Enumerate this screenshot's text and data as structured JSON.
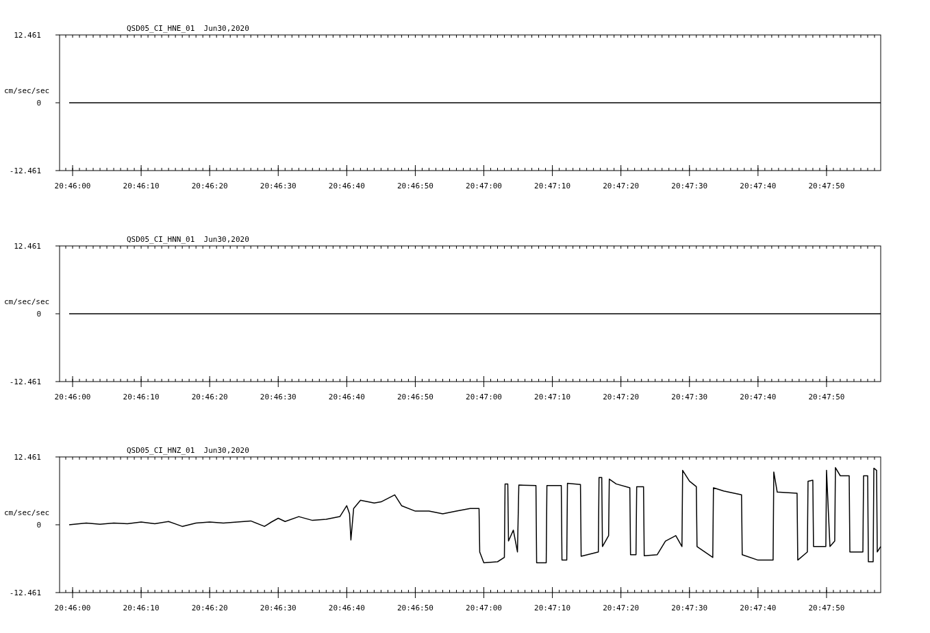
{
  "charts": [
    {
      "chart_data": {
        "type": "line",
        "title": "QSD05_CI_HNE_01  Jun30,2020",
        "ylabel": "cm/sec/sec",
        "xlim": [
          74758.1,
          74877.9
        ],
        "ylim": [
          -12.461,
          12.461
        ],
        "yticks": [
          {
            "value": 12.461,
            "label": "12.461"
          },
          {
            "value": 0,
            "label": "0"
          },
          {
            "value": -12.461,
            "label": "-12.461"
          }
        ],
        "xticks": [
          {
            "value": 74760,
            "label": "20:46:00"
          },
          {
            "value": 74770,
            "label": "20:46:10"
          },
          {
            "value": 74780,
            "label": "20:46:20"
          },
          {
            "value": 74790,
            "label": "20:46:30"
          },
          {
            "value": 74800,
            "label": "20:46:40"
          },
          {
            "value": 74810,
            "label": "20:46:50"
          },
          {
            "value": 74820,
            "label": "20:47:00"
          },
          {
            "value": 74830,
            "label": "20:47:10"
          },
          {
            "value": 74840,
            "label": "20:47:20"
          },
          {
            "value": 74850,
            "label": "20:47:30"
          },
          {
            "value": 74860,
            "label": "20:47:40"
          },
          {
            "value": 74870,
            "label": "20:47:50"
          }
        ],
        "x": [
          74759.5,
          74877.9
        ],
        "series": [
          {
            "color": "#000000",
            "values": [
              0,
              0
            ]
          }
        ]
      }
    },
    {
      "chart_data": {
        "type": "line",
        "title": "QSD05_CI_HNN_01  Jun30,2020",
        "ylabel": "cm/sec/sec",
        "xlim": [
          74758.1,
          74877.9
        ],
        "ylim": [
          -12.461,
          12.461
        ],
        "yticks": [
          {
            "value": 12.461,
            "label": "12.461"
          },
          {
            "value": 0,
            "label": "0"
          },
          {
            "value": -12.461,
            "label": "-12.461"
          }
        ],
        "xticks": [
          {
            "value": 74760,
            "label": "20:46:00"
          },
          {
            "value": 74770,
            "label": "20:46:10"
          },
          {
            "value": 74780,
            "label": "20:46:20"
          },
          {
            "value": 74790,
            "label": "20:46:30"
          },
          {
            "value": 74800,
            "label": "20:46:40"
          },
          {
            "value": 74810,
            "label": "20:46:50"
          },
          {
            "value": 74820,
            "label": "20:47:00"
          },
          {
            "value": 74830,
            "label": "20:47:10"
          },
          {
            "value": 74840,
            "label": "20:47:20"
          },
          {
            "value": 74850,
            "label": "20:47:30"
          },
          {
            "value": 74860,
            "label": "20:47:40"
          },
          {
            "value": 74870,
            "label": "20:47:50"
          }
        ],
        "x": [
          74759.5,
          74877.9
        ],
        "series": [
          {
            "color": "#000000",
            "values": [
              0,
              0
            ]
          }
        ]
      }
    },
    {
      "chart_data": {
        "type": "line",
        "title": "QSD05_CI_HNZ_01  Jun30,2020",
        "ylabel": "cm/sec/sec",
        "xlim": [
          74758.1,
          74877.9
        ],
        "ylim": [
          -12.461,
          12.461
        ],
        "yticks": [
          {
            "value": 12.461,
            "label": "12.461"
          },
          {
            "value": 0,
            "label": "0"
          },
          {
            "value": -12.461,
            "label": "-12.461"
          }
        ],
        "xticks": [
          {
            "value": 74760,
            "label": "20:46:00"
          },
          {
            "value": 74770,
            "label": "20:46:10"
          },
          {
            "value": 74780,
            "label": "20:46:20"
          },
          {
            "value": 74790,
            "label": "20:46:30"
          },
          {
            "value": 74800,
            "label": "20:46:40"
          },
          {
            "value": 74810,
            "label": "20:46:50"
          },
          {
            "value": 74820,
            "label": "20:47:00"
          },
          {
            "value": 74830,
            "label": "20:47:10"
          },
          {
            "value": 74840,
            "label": "20:47:20"
          },
          {
            "value": 74850,
            "label": "20:47:30"
          },
          {
            "value": 74860,
            "label": "20:47:40"
          },
          {
            "value": 74870,
            "label": "20:47:50"
          }
        ],
        "x": [
          74759.5,
          74762,
          74764,
          74766,
          74768,
          74770,
          74772,
          74774,
          74776,
          74778,
          74780,
          74782,
          74784,
          74786,
          74788,
          74789,
          74790,
          74791,
          74793,
          74795,
          74797,
          74799,
          74800,
          74800.4,
          74800.6,
          74801,
          74802,
          74804,
          74805,
          74807,
          74808,
          74810,
          74812,
          74814,
          74816,
          74818,
          74819.3,
          74819.4,
          74820,
          74822,
          74823,
          74823.1,
          74823.5,
          74823.6,
          74824.3,
          74824.9,
          74825.1,
          74827.6,
          74827.7,
          74829.1,
          74829.2,
          74831.3,
          74831.4,
          74832.1,
          74832.2,
          74834.1,
          74834.2,
          74836.7,
          74836.8,
          74837.2,
          74837.3,
          74838.2,
          74838.3,
          74839.3,
          74841.3,
          74841.4,
          74842.2,
          74842.3,
          74843.3,
          74843.4,
          74845.3,
          74846.5,
          74848,
          74848.9,
          74849,
          74850,
          74851,
          74851.1,
          74853.4,
          74853.5,
          74855,
          74857.6,
          74857.7,
          74860,
          74862.2,
          74862.3,
          74862.8,
          74865.7,
          74865.8,
          74867.2,
          74867.3,
          74868,
          74868.1,
          74869.9,
          74870,
          74870.5,
          74871.2,
          74871.3,
          74872,
          74873.3,
          74873.4,
          74875.3,
          74875.4,
          74876,
          74876.1,
          74876.8,
          74876.9,
          74877.3,
          74877.4,
          74877.9
        ],
        "series": [
          {
            "color": "#000000",
            "values": [
              0,
              0.3,
              0.1,
              0.3,
              0.2,
              0.5,
              0.2,
              0.6,
              -0.3,
              0.3,
              0.5,
              0.3,
              0.5,
              0.7,
              -0.3,
              0.5,
              1.2,
              0.6,
              1.5,
              0.8,
              1,
              1.5,
              3.5,
              2,
              -2.8,
              3,
              4.5,
              4,
              4.2,
              5.5,
              3.5,
              2.5,
              2.5,
              2,
              2.5,
              3,
              3,
              -5,
              -7,
              -6.8,
              -6,
              7.5,
              7.5,
              -3,
              -1,
              -5,
              7.3,
              7.2,
              -7,
              -7,
              7.2,
              7.2,
              -6.5,
              -6.5,
              7.6,
              7.4,
              -5.8,
              -5,
              8.7,
              8.7,
              -4,
              -2,
              8.4,
              7.5,
              6.8,
              -5.5,
              -5.5,
              7,
              7,
              -5.7,
              -5.5,
              -3,
              -2,
              -4,
              10,
              8,
              7,
              -4,
              -6,
              6.8,
              6.2,
              5.5,
              -5.5,
              -6.5,
              -6.5,
              9.7,
              6,
              5.8,
              -6.5,
              -5,
              8,
              8.2,
              -4,
              -4,
              10,
              -4,
              -3,
              10.5,
              9,
              9,
              -5,
              -5,
              9,
              9,
              -6.8,
              -6.8,
              10.4,
              10,
              -5,
              -4
            ]
          }
        ]
      }
    }
  ]
}
